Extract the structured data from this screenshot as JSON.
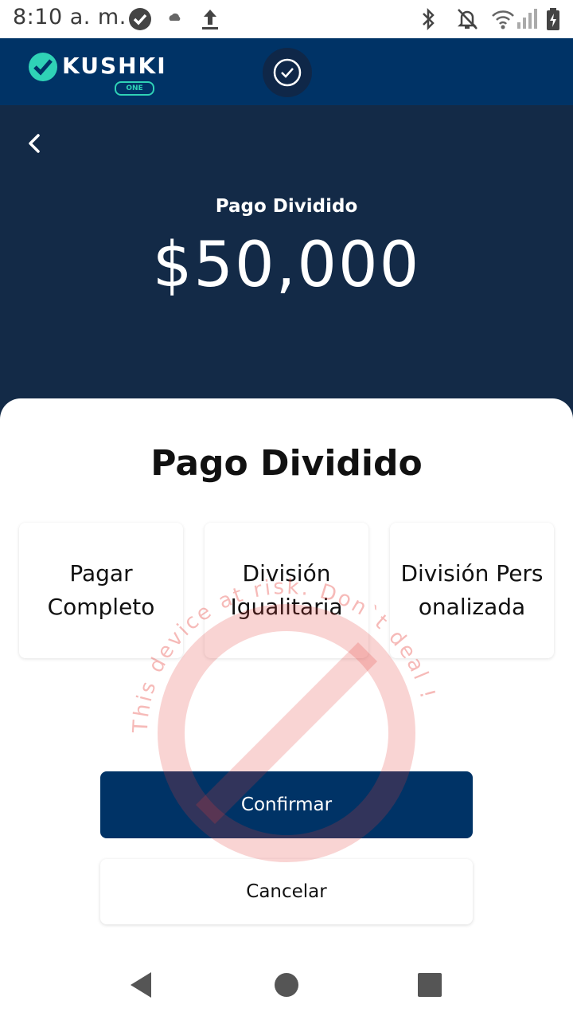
{
  "status_bar": {
    "time": "8:10 a. m.",
    "icons": [
      "check-circle-icon",
      "cloud-icon",
      "upload-icon",
      "bluetooth-icon",
      "bell-off-icon",
      "wifi-icon",
      "signal-icon",
      "battery-charging-icon"
    ]
  },
  "header": {
    "logo_text": "KUSHKI",
    "logo_badge": "ONE",
    "brand_color": "#2fd2b6",
    "status_icon": "check-circle-icon"
  },
  "hero": {
    "title": "Pago Dividido",
    "amount": "$50,000"
  },
  "sheet": {
    "title": "Pago Dividido",
    "options": [
      {
        "label": "Pagar Completo"
      },
      {
        "label": "División Igualitaria"
      },
      {
        "label": "División Personalizada"
      }
    ],
    "confirm_label": "Confirmar",
    "cancel_label": "Cancelar"
  },
  "watermark": {
    "text": "This device at risk. Don`t deal !",
    "color": "#e53935"
  },
  "nav": {
    "icons": [
      "back-triangle-icon",
      "home-circle-icon",
      "recents-square-icon"
    ]
  },
  "colors": {
    "header_bg": "#003366",
    "hero_bg": "#132a47",
    "primary": "#003366"
  }
}
